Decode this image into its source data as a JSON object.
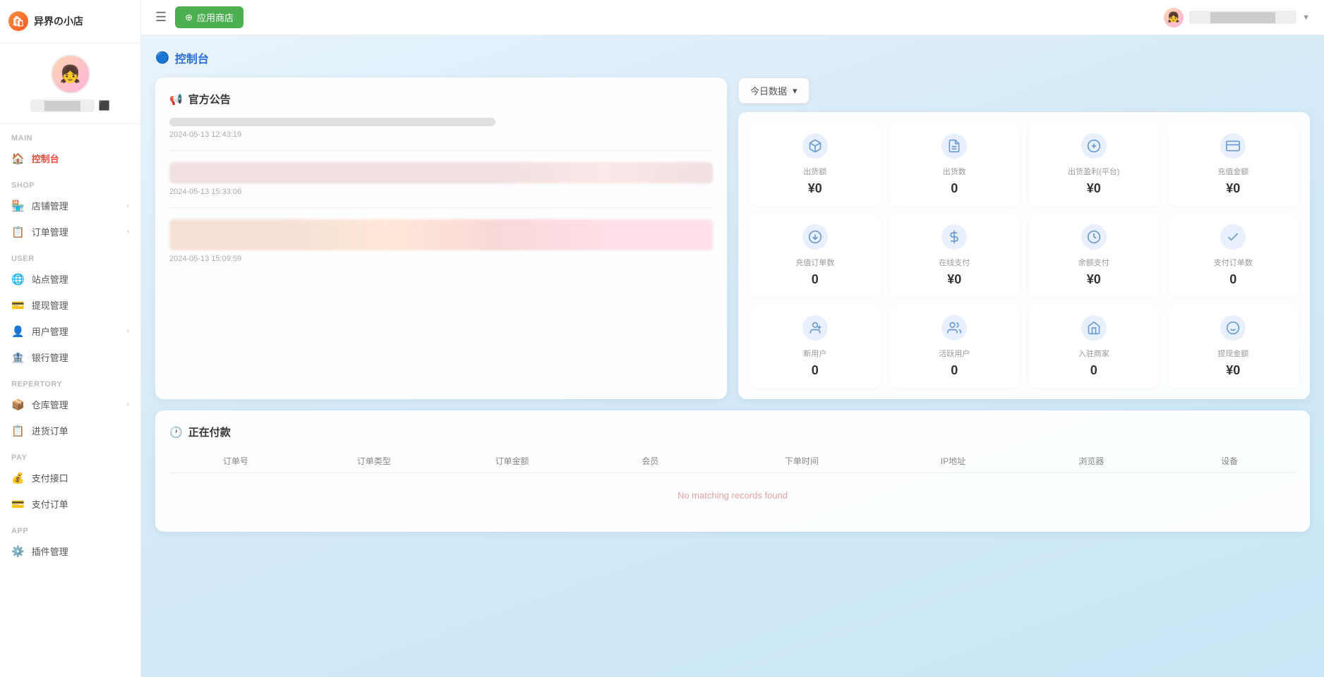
{
  "brand": {
    "name": "异界の小店",
    "icon": "🛍"
  },
  "user": {
    "name": "██████",
    "avatar": "👧"
  },
  "topbar": {
    "app_store_label": "⊕ 应用商店",
    "username": "██████████",
    "chevron": "▼"
  },
  "page_title": {
    "icon": "🔵",
    "label": "控制台"
  },
  "sidebar": {
    "sections": [
      {
        "label": "MAIN",
        "items": [
          {
            "id": "dashboard",
            "icon": "🏠",
            "label": "控制台",
            "active": true,
            "hasChevron": false
          }
        ]
      },
      {
        "label": "SHOP",
        "items": [
          {
            "id": "store",
            "icon": "🏪",
            "label": "店铺管理",
            "active": false,
            "hasChevron": true
          },
          {
            "id": "orders",
            "icon": "📋",
            "label": "订单管理",
            "active": false,
            "hasChevron": true
          }
        ]
      },
      {
        "label": "USER",
        "items": [
          {
            "id": "site",
            "icon": "🌐",
            "label": "站点管理",
            "active": false,
            "hasChevron": false
          },
          {
            "id": "withdraw",
            "icon": "💳",
            "label": "提现管理",
            "active": false,
            "hasChevron": false
          },
          {
            "id": "users",
            "icon": "👤",
            "label": "用户管理",
            "active": false,
            "hasChevron": true
          },
          {
            "id": "bank",
            "icon": "🏦",
            "label": "银行管理",
            "active": false,
            "hasChevron": false
          }
        ]
      },
      {
        "label": "REPERTORY",
        "items": [
          {
            "id": "warehouse",
            "icon": "📦",
            "label": "仓库管理",
            "active": false,
            "hasChevron": true
          },
          {
            "id": "restock",
            "icon": "📋",
            "label": "进货订单",
            "active": false,
            "hasChevron": false
          }
        ]
      },
      {
        "label": "PAY",
        "items": [
          {
            "id": "payment-api",
            "icon": "💰",
            "label": "支付接口",
            "active": false,
            "hasChevron": false
          },
          {
            "id": "payment-orders",
            "icon": "💳",
            "label": "支付订单",
            "active": false,
            "hasChevron": false
          }
        ]
      },
      {
        "label": "APP",
        "items": [
          {
            "id": "plugins",
            "icon": "⚙️",
            "label": "插件管理",
            "active": false,
            "hasChevron": false
          }
        ]
      }
    ]
  },
  "announcement": {
    "section_icon": "📢",
    "section_title": "官方公告",
    "items": [
      {
        "date": "2024-05-13 12:43:19"
      },
      {
        "date": "2024-05-13 15:33:06"
      },
      {
        "date": "2024-05-13 15:09:59"
      }
    ]
  },
  "stats": {
    "date_label": "今日数据",
    "rows": [
      [
        {
          "icon": "📦",
          "label": "出货额",
          "value": "¥0"
        },
        {
          "icon": "📄",
          "label": "出货数",
          "value": "0"
        },
        {
          "icon": "💹",
          "label": "出货盈利(平台)",
          "value": "¥0"
        },
        {
          "icon": "💳",
          "label": "充值金额",
          "value": "¥0"
        }
      ],
      [
        {
          "icon": "📝",
          "label": "充值订单数",
          "value": "0"
        },
        {
          "icon": "💴",
          "label": "在线支付",
          "value": "¥0"
        },
        {
          "icon": "💰",
          "label": "余额支付",
          "value": "¥0"
        },
        {
          "icon": "✅",
          "label": "支付订单数",
          "value": "0"
        }
      ],
      [
        {
          "icon": "👤",
          "label": "新用户",
          "value": "0"
        },
        {
          "icon": "👥",
          "label": "活跃用户",
          "value": "0"
        },
        {
          "icon": "🏪",
          "label": "入驻商家",
          "value": "0"
        },
        {
          "icon": "💸",
          "label": "提现金额",
          "value": "¥0"
        }
      ]
    ]
  },
  "payment_table": {
    "section_icon": "🕐",
    "section_title": "正在付款",
    "columns": [
      "订单号",
      "订单类型",
      "订单金额",
      "会员",
      "下单时间",
      "IP地址",
      "浏览器",
      "设备"
    ],
    "empty_text": "No matching records found"
  }
}
